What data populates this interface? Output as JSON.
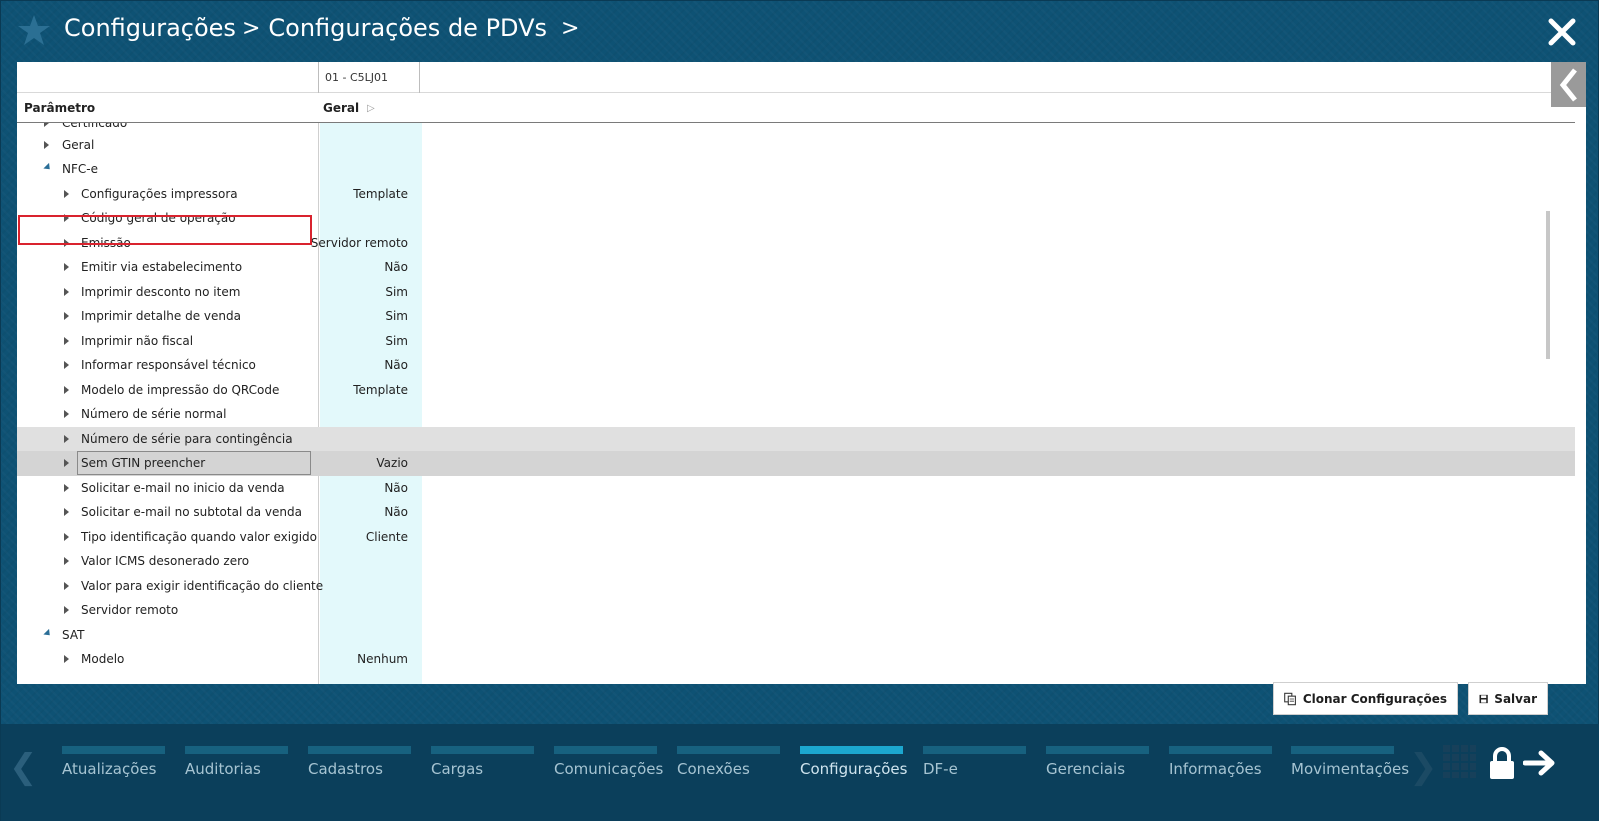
{
  "header": {
    "crumb1": "Configurações",
    "crumb2": "Configurações de PDVs",
    "sep": ">"
  },
  "grid": {
    "store_column": "01 - C5LJ01",
    "param_header": "Parâmetro",
    "group_header": "Geral",
    "rows": [
      {
        "label": "Certificado",
        "value": ""
      },
      {
        "label": "Geral",
        "value": ""
      },
      {
        "label": "NFC-e",
        "value": ""
      },
      {
        "label": "Configurações impressora",
        "value": "Template"
      },
      {
        "label": "Código geral de operação",
        "value": ""
      },
      {
        "label": "Emissão",
        "value": "Servidor remoto"
      },
      {
        "label": "Emitir via estabelecimento",
        "value": "Não"
      },
      {
        "label": "Imprimir desconto no item",
        "value": "Sim"
      },
      {
        "label": "Imprimir detalhe de venda",
        "value": "Sim"
      },
      {
        "label": "Imprimir não fiscal",
        "value": "Sim"
      },
      {
        "label": "Informar responsável técnico",
        "value": "Não"
      },
      {
        "label": "Modelo de impressão do QRCode",
        "value": "Template"
      },
      {
        "label": "Número de série normal",
        "value": ""
      },
      {
        "label": "Número de série para contingência",
        "value": ""
      },
      {
        "label": "Sem GTIN preencher",
        "value": "Vazio"
      },
      {
        "label": "Solicitar e-mail no inicio da venda",
        "value": "Não"
      },
      {
        "label": "Solicitar e-mail no subtotal da venda",
        "value": "Não"
      },
      {
        "label": "Tipo identificação quando valor exigido",
        "value": "Cliente"
      },
      {
        "label": "Valor ICMS desonerado zero",
        "value": ""
      },
      {
        "label": "Valor para exigir identificação do cliente",
        "value": ""
      },
      {
        "label": "Servidor remoto",
        "value": ""
      },
      {
        "label": "SAT",
        "value": ""
      },
      {
        "label": "Modelo",
        "value": "Nenhum"
      }
    ]
  },
  "buttons": {
    "clone": "Clonar Configurações",
    "save": "Salvar"
  },
  "nav": {
    "items": [
      {
        "label": "Atualizações"
      },
      {
        "label": "Auditorias"
      },
      {
        "label": "Cadastros"
      },
      {
        "label": "Cargas"
      },
      {
        "label": "Comunicações"
      },
      {
        "label": "Conexões"
      },
      {
        "label": "Configurações"
      },
      {
        "label": "DF-e"
      },
      {
        "label": "Gerenciais"
      },
      {
        "label": "Informações"
      },
      {
        "label": "Movimentações"
      }
    ],
    "active": "Configurações"
  },
  "colors": {
    "accent": "#1ca7cf",
    "highlight": "#d9232e",
    "value_band": "#e3f9fb"
  },
  "icons": [
    "star-icon",
    "close-icon",
    "chevron-left-icon",
    "clone-icon",
    "save-icon",
    "apps-grid-icon",
    "lock-icon",
    "logout-arrow-icon"
  ]
}
